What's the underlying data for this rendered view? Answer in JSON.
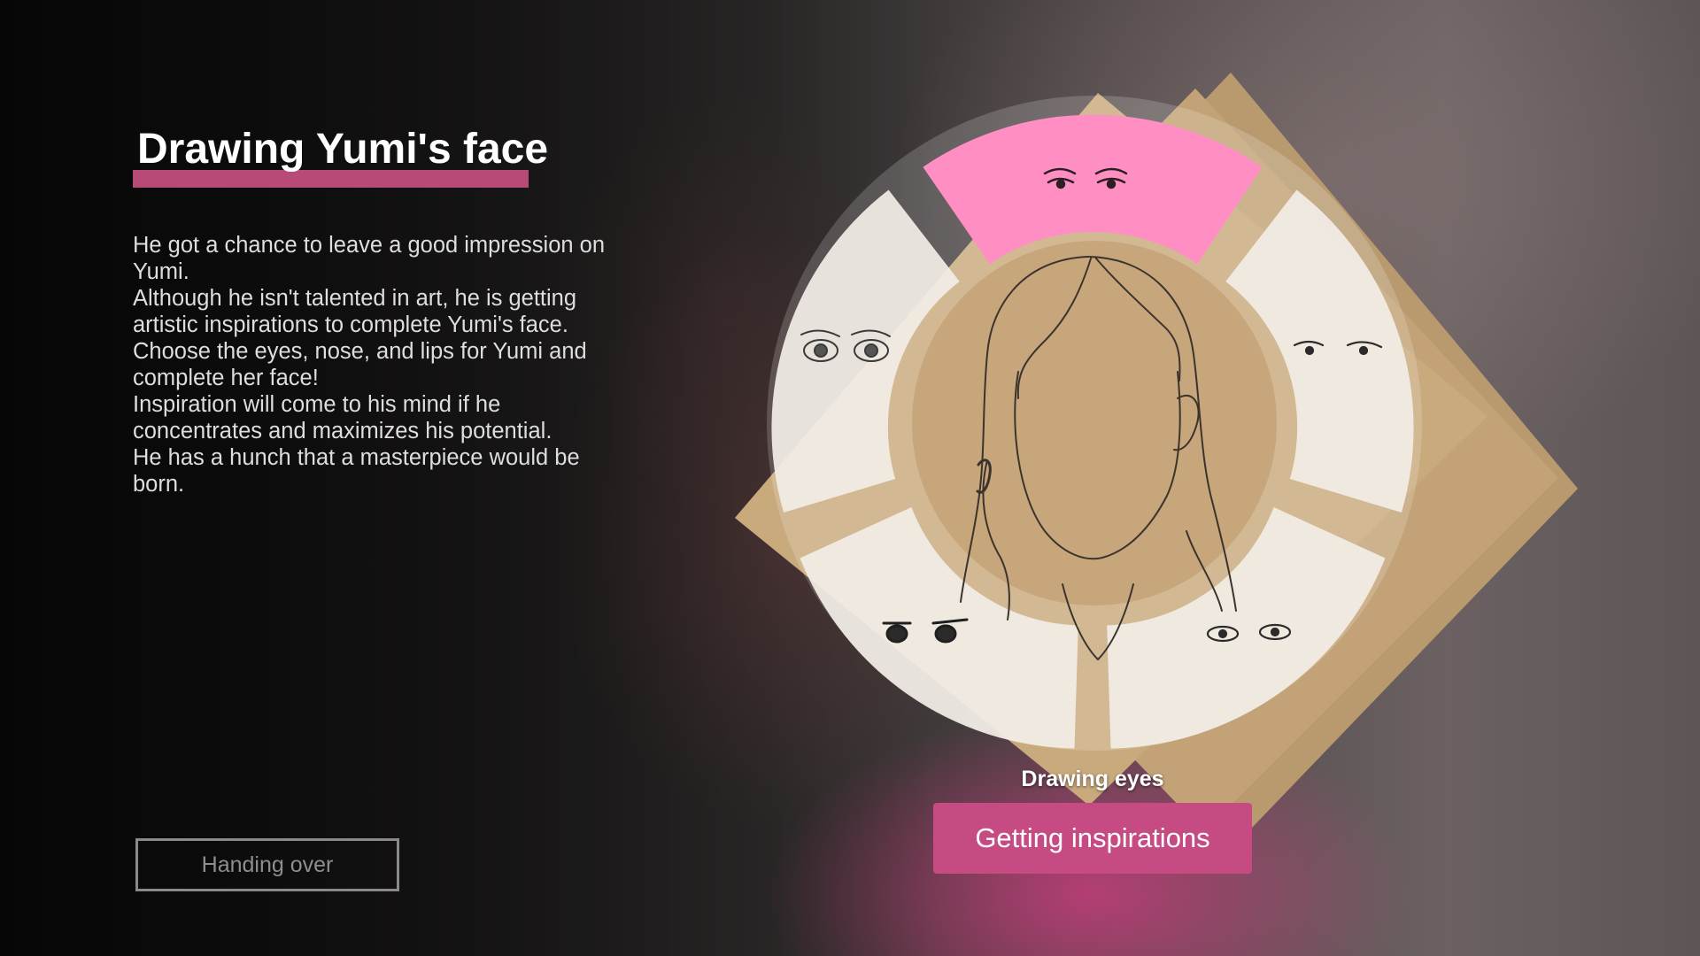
{
  "panel": {
    "title": "Drawing Yumi's face",
    "description": [
      "He got a chance to leave a good impression on Yumi.",
      "Although he isn't talented in art, he is getting artistic inspirations to complete Yumi's face.",
      "Choose the eyes, nose, and lips for Yumi and complete her face!",
      "Inspiration will come to his mind if he concentrates and maximizes his potential.",
      "He has a hunch that a masterpiece would be born."
    ],
    "handing_over_label": "Handing over"
  },
  "wheel": {
    "status_label": "Drawing eyes",
    "inspire_button_label": "Getting inspirations",
    "selected_segment": "top",
    "segments": [
      {
        "position": "top",
        "icon": "eyes-style-1-icon",
        "selected": true
      },
      {
        "position": "upper-right",
        "icon": "eyes-style-2-icon",
        "selected": false
      },
      {
        "position": "lower-right",
        "icon": "eyes-style-3-icon",
        "selected": false
      },
      {
        "position": "lower-left",
        "icon": "eyes-style-4-icon",
        "selected": false
      },
      {
        "position": "upper-left",
        "icon": "eyes-style-5-icon",
        "selected": false
      }
    ]
  },
  "colors": {
    "accent": "#b84a78",
    "button": "#c64b83",
    "selected_segment": "#ff8ec2",
    "segment": "#f2ede6",
    "paper": "#c7a87c"
  }
}
